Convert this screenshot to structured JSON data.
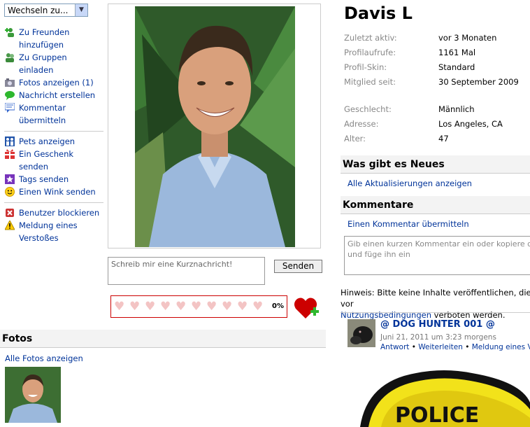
{
  "menu": {
    "select_label": "Wechseln zu...",
    "items": [
      {
        "label": "Zu Freunden hinzufügen",
        "icon": "add-friend-icon"
      },
      {
        "label": "Zu Gruppen einladen",
        "icon": "group-invite-icon"
      },
      {
        "label": "Fotos anzeigen (1)",
        "icon": "photo-icon"
      },
      {
        "label": "Nachricht erstellen",
        "icon": "message-icon"
      },
      {
        "label": "Kommentar übermitteln",
        "icon": "comment-icon"
      },
      {
        "label": "Pets anzeigen",
        "icon": "pets-icon"
      },
      {
        "label": "Ein Geschenk senden",
        "icon": "gift-icon"
      },
      {
        "label": "Tags senden",
        "icon": "star-icon"
      },
      {
        "label": "Einen Wink senden",
        "icon": "smiley-icon"
      },
      {
        "label": "Benutzer blockieren",
        "icon": "block-icon"
      },
      {
        "label": "Meldung eines Verstoßes",
        "icon": "warning-icon"
      }
    ]
  },
  "shoutbox": {
    "placeholder": "Schreib mir eine Kurznachricht!",
    "send_label": "Senden"
  },
  "rating": {
    "percent": "0%",
    "hearts": 10
  },
  "photos": {
    "title": "Fotos",
    "view_all": "Alle Fotos anzeigen"
  },
  "profile": {
    "name": "Davis L",
    "fields": [
      {
        "k": "Zuletzt aktiv:",
        "v": "vor 3 Monaten"
      },
      {
        "k": "Profilaufrufe:",
        "v": "1161 Mal"
      },
      {
        "k": "Profil-Skin:",
        "v": "Standard"
      },
      {
        "k": "Mitglied seit:",
        "v": "30 September 2009"
      },
      {
        "k": "Geschlecht:",
        "v": "Männlich"
      },
      {
        "k": "Adresse:",
        "v": "Los Angeles, CA"
      },
      {
        "k": "Alter:",
        "v": "47"
      }
    ]
  },
  "news": {
    "title": "Was gibt es Neues",
    "link": "Alle Aktualisierungen anzeigen"
  },
  "comments": {
    "title": "Kommentare",
    "submit_link": "Einen Kommentar übermitteln",
    "placeholder": "Gib einen kurzen Kommentar ein oder kopiere d und füge ihn ein",
    "hint_prefix": "Hinweis: Bitte keine Inhalte veröffentlichen, die vor",
    "hint_link": "Nutzungsbedingungen",
    "hint_suffix": " verboten werden.",
    "entry": {
      "author": "@ DOG HUNTER 001 @",
      "date": "Juni 21, 2011 um 3:23 morgens",
      "reply": "Antwort",
      "forward": "Weiterleiten",
      "report": "Meldung eines Ver"
    },
    "badge_text": "POLICE"
  },
  "colors": {
    "link": "#003399",
    "heart_border": "#cc0000",
    "heart_empty": "#f3c4c4"
  }
}
